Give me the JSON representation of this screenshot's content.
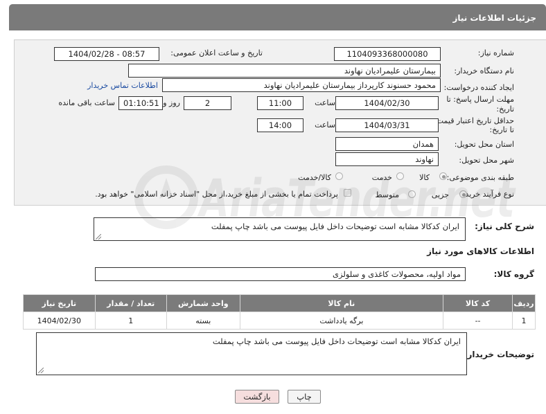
{
  "header": {
    "title": "جزئیات اطلاعات نیاز"
  },
  "form": {
    "need_number": {
      "label": "شماره نیاز:",
      "value": "1104093368000080"
    },
    "announce": {
      "label": "تاریخ و ساعت اعلان عمومی:",
      "value": "1404/02/28 - 08:57"
    },
    "buyer_org": {
      "label": "نام دستگاه خریدار:",
      "value": "بیمارستان علیمرادیان نهاوند"
    },
    "requester": {
      "label": "ایجاد کننده درخواست:",
      "value": "محمود حسنوند کارپرداز بیمارستان علیمرادیان نهاوند",
      "contact_link": "اطلاعات تماس خریدار"
    },
    "reply_deadline": {
      "label_line1": "مهلت ارسال پاسخ: تا",
      "label_line2": "تاریخ:",
      "date": "1404/02/30",
      "time_label": "ساعت",
      "time": "11:00",
      "days": "2",
      "days_label": "روز و",
      "remaining": "01:10:51",
      "remaining_label": "ساعت باقی مانده"
    },
    "price_validity": {
      "label_line1": "حداقل تاریخ اعتبار قیمت:",
      "label_line2": "تا تاریخ:",
      "date": "1404/03/31",
      "time_label": "ساعت",
      "time": "14:00"
    },
    "province": {
      "label": "استان محل تحویل:",
      "value": "همدان"
    },
    "city": {
      "label": "شهر محل تحویل:",
      "value": "نهاوند"
    },
    "category": {
      "label": "طبقه بندی موضوعی:",
      "options": [
        "کالا",
        "خدمت",
        "کالا/خدمت"
      ],
      "selected": "کالا"
    },
    "process": {
      "label": "نوع فرآیند خرید :",
      "options": [
        "جزیی",
        "متوسط"
      ],
      "selected": "جزیی",
      "payment_note": "پرداخت تمام یا بخشی از مبلغ خرید،از محل \"اسناد خزانه اسلامی\" خواهد بود."
    }
  },
  "description": {
    "label": "شرح کلی نیاز:",
    "value": "ایران کدکالا مشابه است توضیحات داخل فایل پیوست می باشد چاپ پمفلت"
  },
  "goods_section": {
    "title": "اطلاعات کالاهای مورد نیاز"
  },
  "goods_group": {
    "label": "گروه کالا:",
    "value": "مواد اولیه، محصولات کاغذی و سلولزی"
  },
  "table": {
    "headers": [
      "ردیف",
      "کد کالا",
      "نام کالا",
      "واحد شمارش",
      "تعداد / مقدار",
      "تاریخ نیاز"
    ],
    "rows": [
      [
        "1",
        "--",
        "برگه یادداشت",
        "بسته",
        "1",
        "1404/02/30"
      ]
    ]
  },
  "buyer_notes": {
    "label": "توضیحات خریدار:",
    "value": "ایران کدکالا مشابه است توضیحات داخل فایل پیوست می باشد چاپ پمفلت"
  },
  "buttons": {
    "print": "چاپ",
    "back": "بازگشت"
  },
  "watermark": {
    "text": "AriaTender.net"
  }
}
